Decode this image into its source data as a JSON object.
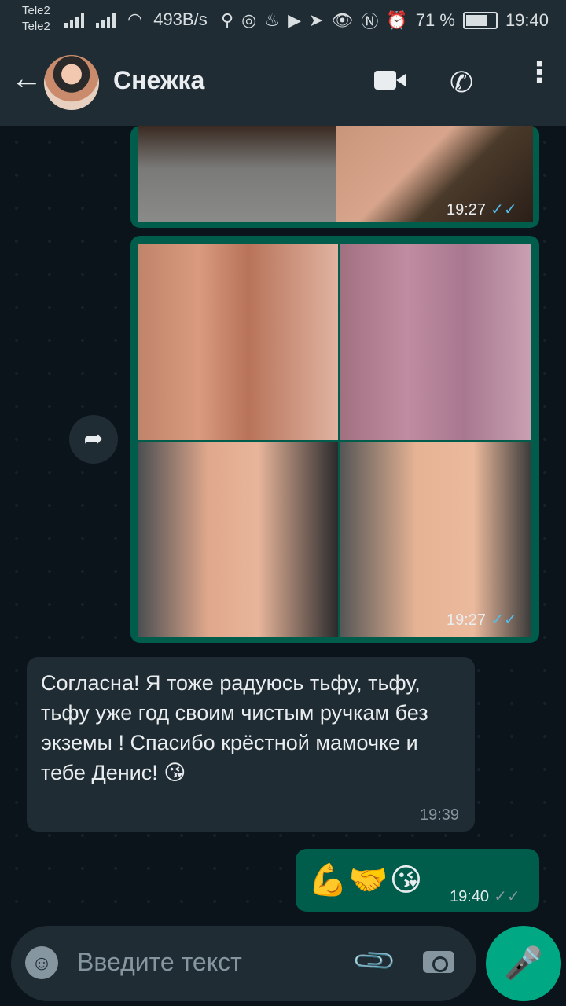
{
  "status_bar": {
    "carrier1": "Tele2",
    "carrier2": "Tele2",
    "net_speed": "493B/s",
    "battery": "71 %",
    "time": "19:40"
  },
  "header": {
    "contact_name": "Снежка"
  },
  "messages": [
    {
      "type": "image",
      "direction": "out",
      "time": "19:27"
    },
    {
      "type": "image_grid",
      "direction": "out",
      "time": "19:27"
    },
    {
      "type": "text",
      "direction": "in",
      "text": "Согласна! Я тоже радуюсь тьфу, тьфу, тьфу уже год своим чистым ручкам без экземы ! Спасибо крёстной мамочке и тебе Денис! 😘",
      "time": "19:39"
    },
    {
      "type": "text",
      "direction": "out",
      "text": "💪🤝😘",
      "time": "19:40"
    }
  ],
  "input": {
    "placeholder": "Введите текст"
  },
  "colors": {
    "header": "#1f2c34",
    "outgoing_bubble": "#005c4b",
    "incoming_bubble": "#202c33",
    "accent": "#00a884",
    "read_ticks": "#53bdeb"
  },
  "icons": [
    "back-arrow-icon",
    "video-call-icon",
    "phone-icon",
    "menu-icon",
    "forward-icon",
    "emoji-icon",
    "attach-icon",
    "camera-icon",
    "mic-icon"
  ]
}
